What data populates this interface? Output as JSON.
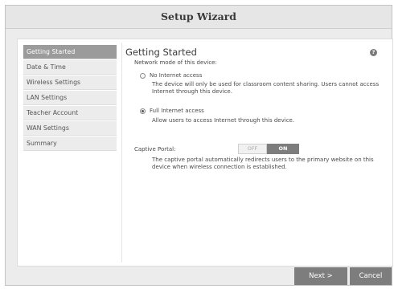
{
  "window": {
    "title": "Setup Wizard"
  },
  "sidebar": {
    "items": [
      {
        "label": "Getting Started",
        "active": true
      },
      {
        "label": "Date & Time",
        "active": false
      },
      {
        "label": "Wireless Settings",
        "active": false
      },
      {
        "label": "LAN Settings",
        "active": false
      },
      {
        "label": "Teacher Account",
        "active": false
      },
      {
        "label": "WAN Settings",
        "active": false
      },
      {
        "label": "Summary",
        "active": false
      }
    ]
  },
  "content": {
    "title": "Getting Started",
    "help_icon": "?",
    "network_mode_label": "Network mode of this device:",
    "options": [
      {
        "label": "No Internet access",
        "selected": false,
        "description": "The device will only be used for classroom content sharing. Users cannot access Internet through this device."
      },
      {
        "label": "Full Internet access",
        "selected": true,
        "description": "Allow users to access Internet through this device."
      }
    ],
    "captive_portal": {
      "label": "Captive Portal:",
      "off_label": "OFF",
      "on_label": "ON",
      "state": "ON",
      "description": "The captive portal automatically redirects users to the primary website on this device when wireless connection is established."
    }
  },
  "footer": {
    "next_label": "Next >",
    "cancel_label": "Cancel"
  },
  "colors": {
    "accent": "#7d7d7d",
    "active_sidebar": "#9b9b9b",
    "background": "#ececec"
  }
}
